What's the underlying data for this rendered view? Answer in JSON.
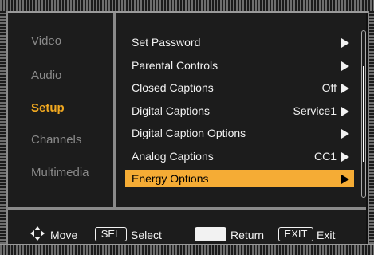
{
  "categories": [
    {
      "label": "Video",
      "active": false
    },
    {
      "label": "Audio",
      "active": false
    },
    {
      "label": "Setup",
      "active": true
    },
    {
      "label": "Channels",
      "active": false
    },
    {
      "label": "Multimedia",
      "active": false
    }
  ],
  "menu": [
    {
      "label": "Set Password",
      "value": ""
    },
    {
      "label": "Parental Controls",
      "value": ""
    },
    {
      "label": "Closed Captions",
      "value": "Off"
    },
    {
      "label": "Digital Captions",
      "value": "Service1"
    },
    {
      "label": "Digital Caption Options",
      "value": ""
    },
    {
      "label": "Analog Captions",
      "value": "CC1"
    },
    {
      "label": "Energy Options",
      "value": "",
      "selected": true
    }
  ],
  "footer": {
    "move_label": "Move",
    "sel_key": "SEL",
    "select_label": "Select",
    "return_label": "Return",
    "exit_key": "EXIT",
    "exit_label": "Exit"
  },
  "colors": {
    "active_category": "#f0a820",
    "selection": "#f5ac35"
  }
}
